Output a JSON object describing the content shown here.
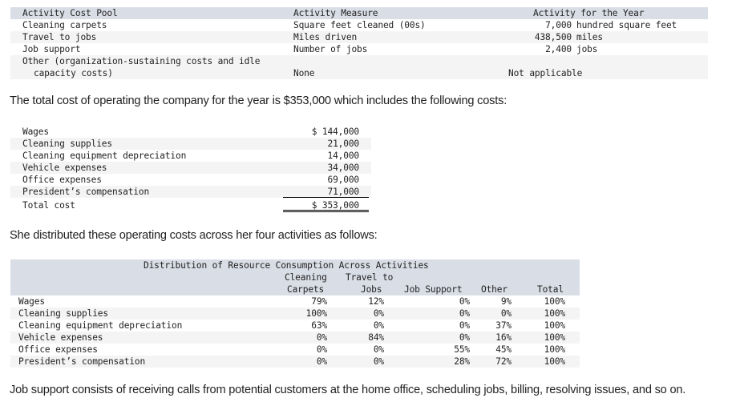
{
  "activity_table": {
    "headers": {
      "pool": "Activity Cost Pool",
      "measure": "Activity Measure",
      "activity": "Activity for the Year"
    },
    "rows": [
      {
        "pool": "Cleaning carpets",
        "measure": "Square feet cleaned (00s)",
        "amount": "7,000",
        "unit": "hundred square feet"
      },
      {
        "pool": "Travel to jobs",
        "measure": "Miles driven",
        "amount": "438,500",
        "unit": "miles"
      },
      {
        "pool": "Job support",
        "measure": "Number of jobs",
        "amount": "2,400",
        "unit": "jobs"
      },
      {
        "pool_line1": "Other (organization-sustaining costs and idle",
        "pool_line2": "capacity costs)",
        "measure": "None",
        "activity": "Not applicable"
      }
    ]
  },
  "text": {
    "total_cost_intro": "The total cost of operating the company for the year is $353,000 which includes the following costs:",
    "distribution_intro": "She distributed these operating costs across her four activities as follows:",
    "job_support_note": "Job support consists of receiving calls from potential customers at the home office, scheduling jobs, billing, resolving issues, and so on."
  },
  "cost_table": {
    "rows": [
      {
        "label": "Wages",
        "value": "$ 144,000"
      },
      {
        "label": "Cleaning supplies",
        "value": "21,000"
      },
      {
        "label": "Cleaning equipment depreciation",
        "value": "14,000"
      },
      {
        "label": "Vehicle expenses",
        "value": "34,000"
      },
      {
        "label": "Office expenses",
        "value": "69,000"
      },
      {
        "label": "President’s compensation",
        "value": "71,000"
      }
    ],
    "total": {
      "label": "Total cost",
      "value": "$ 353,000"
    }
  },
  "distribution_table": {
    "title": "Distribution of Resource Consumption Across Activities",
    "headers": {
      "cleaning_line1": "Cleaning",
      "cleaning_line2": "Carpets",
      "travel_line1": "Travel to",
      "travel_line2": "Jobs",
      "job_support": "Job Support",
      "other": "Other",
      "total": "Total"
    },
    "rows": [
      {
        "label": "Wages",
        "cleaning": "79%",
        "travel": "12%",
        "job_support": "0%",
        "other": "9%",
        "total": "100%"
      },
      {
        "label": "Cleaning supplies",
        "cleaning": "100%",
        "travel": "0%",
        "job_support": "0%",
        "other": "0%",
        "total": "100%"
      },
      {
        "label": "Cleaning equipment depreciation",
        "cleaning": "63%",
        "travel": "0%",
        "job_support": "0%",
        "other": "37%",
        "total": "100%"
      },
      {
        "label": "Vehicle expenses",
        "cleaning": "0%",
        "travel": "84%",
        "job_support": "0%",
        "other": "16%",
        "total": "100%"
      },
      {
        "label": "Office expenses",
        "cleaning": "0%",
        "travel": "0%",
        "job_support": "55%",
        "other": "45%",
        "total": "100%"
      },
      {
        "label": "President’s compensation",
        "cleaning": "0%",
        "travel": "0%",
        "job_support": "28%",
        "other": "72%",
        "total": "100%"
      }
    ]
  }
}
